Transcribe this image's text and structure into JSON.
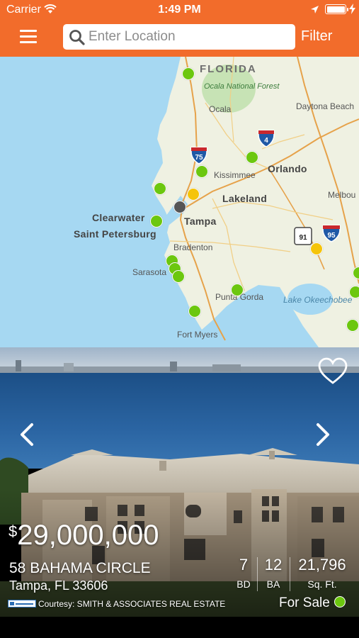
{
  "status_bar": {
    "carrier": "Carrier",
    "time": "1:49 PM"
  },
  "header": {
    "search_placeholder": "Enter Location",
    "filter_label": "Filter",
    "color": "#f26c2b"
  },
  "map": {
    "state_label": "FLORIDA",
    "park_label": "Ocala National Forest",
    "lake_label": "Lake Okeechobee",
    "cities": [
      "Ocala",
      "Daytona Beach",
      "Orlando",
      "Kissimmee",
      "Lakeland",
      "Melbou",
      "Clearwater",
      "Saint Petersburg",
      "Tampa",
      "Bradenton",
      "Sarasota",
      "Punta Gorda",
      "Fort Myers"
    ],
    "highway_shields": [
      "75",
      "4",
      "91",
      "95"
    ],
    "pin_colors": {
      "active": "#6cc70f",
      "pending": "#f5c40a",
      "selected": "#555555"
    }
  },
  "listing": {
    "currency": "$",
    "price": "29,000,000",
    "address": "58 BAHAMA CIRCLE",
    "city_state": "Tampa, FL 33606",
    "courtesy": "Courtesy: SMITH & ASSOCIATES REAL ESTATE",
    "beds": {
      "value": "7",
      "label": "BD"
    },
    "baths": {
      "value": "12",
      "label": "BA"
    },
    "sqft": {
      "value": "21,796",
      "label": "Sq. Ft."
    },
    "status": "For Sale",
    "status_color": "#6cc70f"
  }
}
